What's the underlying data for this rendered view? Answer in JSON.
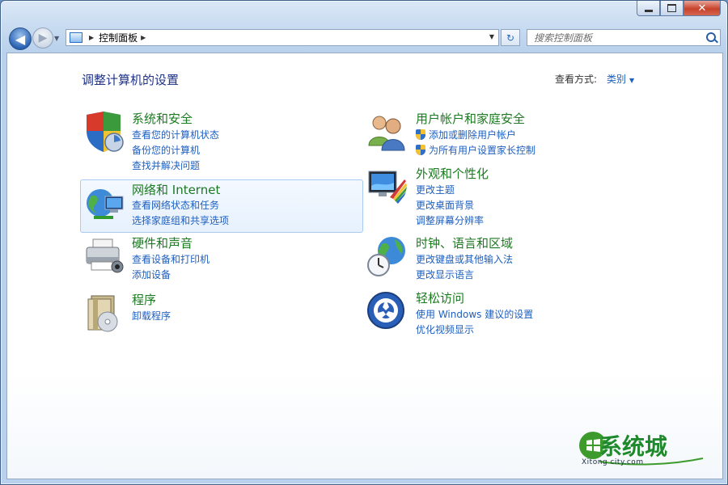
{
  "window": {
    "address_path": "控制面板",
    "search_placeholder": "搜索控制面板"
  },
  "main": {
    "heading": "调整计算机的设置",
    "view_by_label": "查看方式:",
    "view_by_value": "类别"
  },
  "categories": [
    {
      "title": "系统和安全",
      "icon": "shield-icon",
      "links": [
        "查看您的计算机状态",
        "备份您的计算机",
        "查找并解决问题"
      ]
    },
    {
      "title": "网络和 Internet",
      "icon": "network-icon",
      "links": [
        "查看网络状态和任务",
        "选择家庭组和共享选项"
      ]
    },
    {
      "title": "硬件和声音",
      "icon": "printer-icon",
      "links": [
        "查看设备和打印机",
        "添加设备"
      ]
    },
    {
      "title": "程序",
      "icon": "programs-icon",
      "links": [
        "卸载程序"
      ]
    },
    {
      "title": "用户帐户和家庭安全",
      "icon": "users-icon",
      "links": [
        "添加或删除用户帐户",
        "为所有用户设置家长控制"
      ]
    },
    {
      "title": "外观和个性化",
      "icon": "monitor-palette-icon",
      "links": [
        "更改主题",
        "更改桌面背景",
        "调整屏幕分辨率"
      ]
    },
    {
      "title": "时钟、语言和区域",
      "icon": "globe-clock-icon",
      "links": [
        "更改键盘或其他输入法",
        "更改显示语言"
      ]
    },
    {
      "title": "轻松访问",
      "icon": "ease-of-access-icon",
      "links": [
        "使用 Windows 建议的设置",
        "优化视频显示"
      ]
    }
  ],
  "watermark": {
    "text": "系统城",
    "sub": "Xitong city.com"
  }
}
